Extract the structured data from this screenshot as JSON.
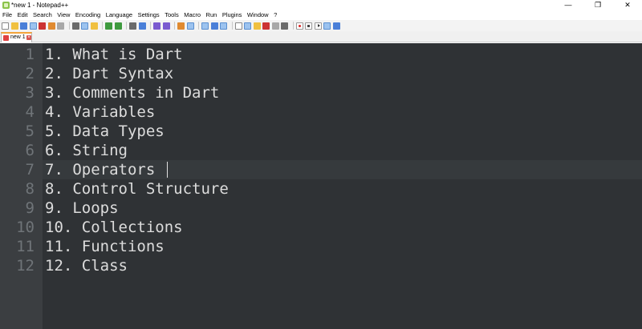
{
  "window": {
    "title": "*new 1 - Notepad++",
    "controls": {
      "minimize": "—",
      "maximize": "❐",
      "close": "✕"
    }
  },
  "menu": {
    "items": [
      "File",
      "Edit",
      "Search",
      "View",
      "Encoding",
      "Language",
      "Settings",
      "Tools",
      "Macro",
      "Run",
      "Plugins",
      "Window",
      "?"
    ]
  },
  "toolbar": {
    "icons": [
      "new-file-icon",
      "open-file-icon",
      "save-icon",
      "save-all-icon",
      "close-icon",
      "close-all-icon",
      "print-icon",
      "cut-icon",
      "copy-icon",
      "paste-icon",
      "undo-icon",
      "redo-icon",
      "find-icon",
      "replace-icon",
      "zoom-in-icon",
      "zoom-out-icon",
      "sync-vertical-icon",
      "sync-horizontal-icon",
      "word-wrap-icon",
      "show-all-chars-icon",
      "indent-guide-icon",
      "user-defined-lang-icon",
      "doc-map-icon",
      "function-list-icon",
      "folder-as-workspace-icon",
      "monitor-icon",
      "record-macro-icon",
      "stop-record-icon",
      "play-macro-icon",
      "run-macro-multiple-icon",
      "save-macro-icon"
    ]
  },
  "tabs": [
    {
      "label": "new 1",
      "active": true
    }
  ],
  "editor": {
    "current_line": 7,
    "lines": [
      {
        "number": "1",
        "text": "1. What is Dart"
      },
      {
        "number": "2",
        "text": "2. Dart Syntax"
      },
      {
        "number": "3",
        "text": "3. Comments in Dart"
      },
      {
        "number": "4",
        "text": "4. Variables"
      },
      {
        "number": "5",
        "text": "5. Data Types"
      },
      {
        "number": "6",
        "text": "6. String"
      },
      {
        "number": "7",
        "text": "7. Operators"
      },
      {
        "number": "8",
        "text": "8. Control Structure"
      },
      {
        "number": "9",
        "text": "9. Loops"
      },
      {
        "number": "10",
        "text": "10. Collections"
      },
      {
        "number": "11",
        "text": "11. Functions"
      },
      {
        "number": "12",
        "text": "12. Class"
      }
    ]
  }
}
